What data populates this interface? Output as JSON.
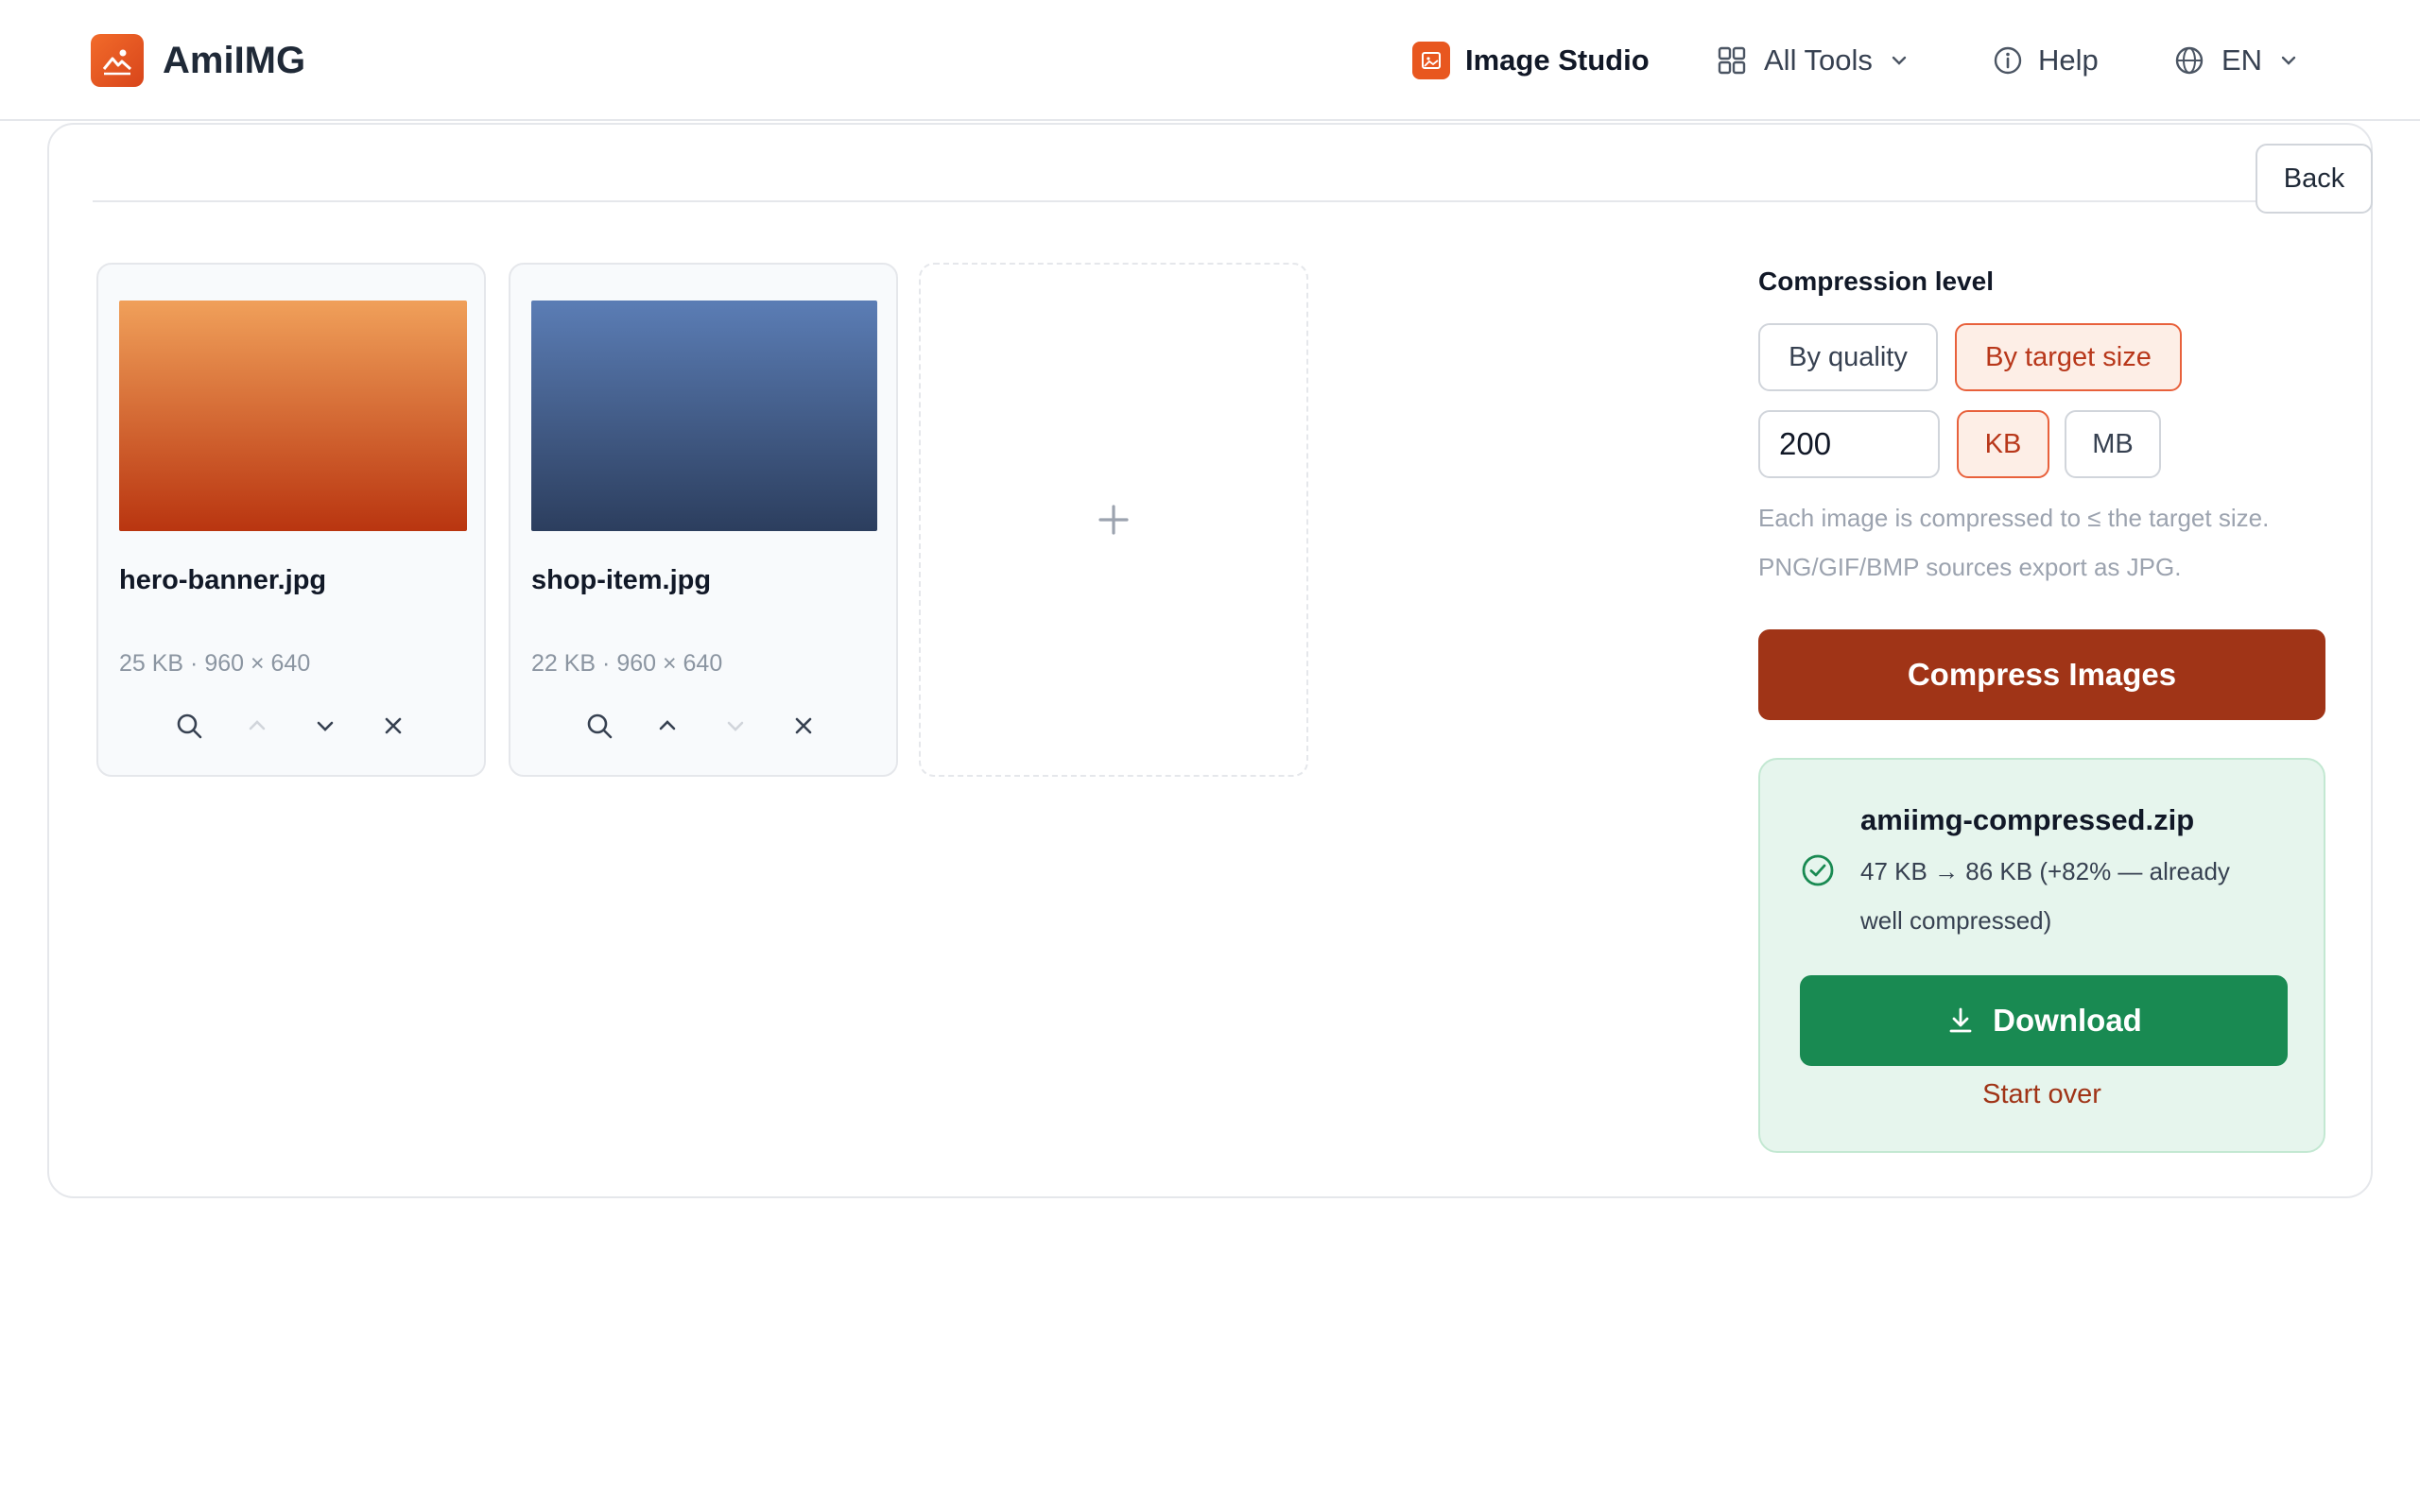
{
  "header": {
    "brand": "AmiIMG",
    "nav": {
      "studio": "Image Studio",
      "all_tools": "All Tools",
      "help": "Help",
      "language": "EN"
    }
  },
  "toolbar": {
    "back_label": "Back"
  },
  "files": [
    {
      "name": "hero-banner.jpg",
      "meta": "25 KB · 960 × 640",
      "colors": [
        "#f0a05a",
        "#b93510"
      ]
    },
    {
      "name": "shop-item.jpg",
      "meta": "22 KB · 960 × 640",
      "colors": [
        "#5b7db5",
        "#2c3e5e"
      ]
    }
  ],
  "add_tile": {
    "icon": "plus-icon"
  },
  "compression": {
    "label": "Compression level",
    "modes": [
      "By quality",
      "By target size"
    ],
    "active_mode": "By target size",
    "target_value": "200",
    "units": [
      "KB",
      "MB"
    ],
    "active_unit": "KB",
    "hint_line1": "Each image is compressed to ≤ the target size.",
    "hint_line2": "PNG/GIF/BMP sources export as JPG.",
    "action_label": "Compress Images"
  },
  "result": {
    "filename": "amiimg-compressed.zip",
    "stats": "47 KB → 86 KB (+82% — already well compressed)",
    "download_label": "Download",
    "start_over_label": "Start over"
  },
  "colors": {
    "brand": "#e8571f",
    "primary": "#a03417",
    "success": "#198a52",
    "success_bg": "#e6f5ed"
  }
}
